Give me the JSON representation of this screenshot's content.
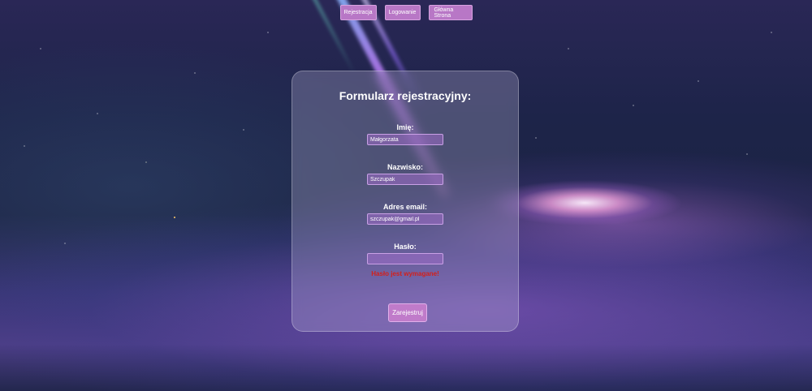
{
  "nav": {
    "register_label": "Rejestracja",
    "login_label": "Logowanie",
    "home_label": "Główna Strona"
  },
  "form": {
    "title": "Formularz rejestracyjny:",
    "first_name": {
      "label": "Imię:",
      "value": "Małgorzata"
    },
    "last_name": {
      "label": "Nazwisko:",
      "value": "Szczupak"
    },
    "email": {
      "label": "Adres email:",
      "value": "szczupak@gmail.pl"
    },
    "password": {
      "label": "Hasło:",
      "value": ""
    },
    "error": "Hasło jest wymagane!",
    "submit_label": "Zarejestruj"
  },
  "colors": {
    "button_bg": "#b877c6",
    "error_text": "#d4201a"
  }
}
